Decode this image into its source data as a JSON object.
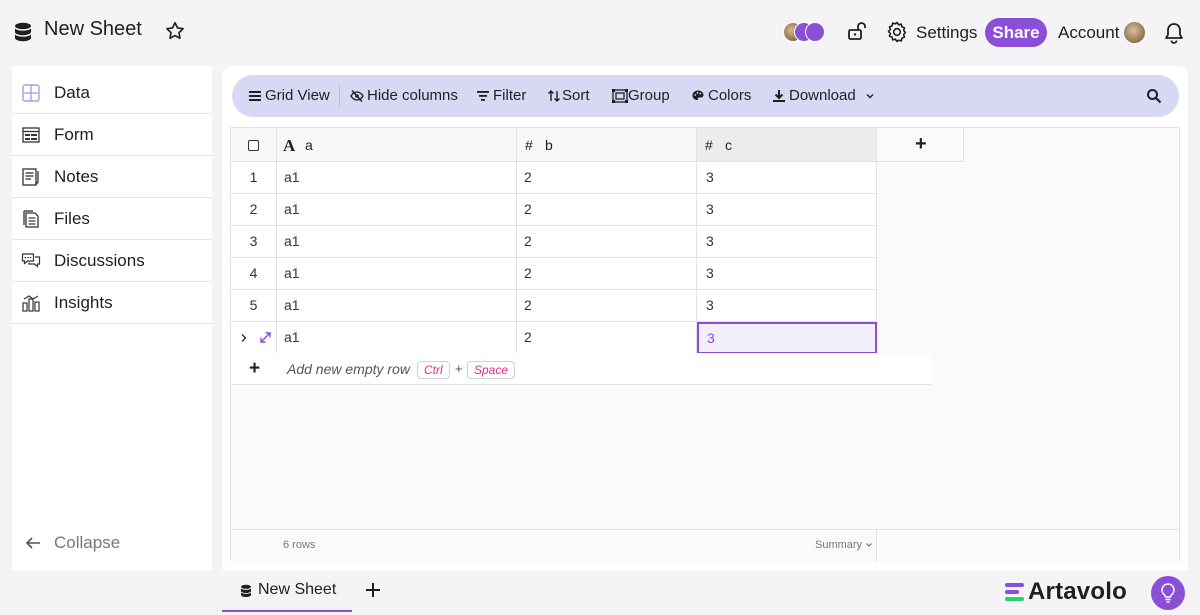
{
  "header": {
    "title": "New Sheet",
    "settings_label": "Settings",
    "share_label": "Share",
    "account_label": "Account"
  },
  "sidebar": {
    "items": [
      {
        "label": "Data",
        "icon": "grid-icon"
      },
      {
        "label": "Form",
        "icon": "form-icon"
      },
      {
        "label": "Notes",
        "icon": "notes-icon"
      },
      {
        "label": "Files",
        "icon": "files-icon"
      },
      {
        "label": "Discussions",
        "icon": "chat-icon"
      },
      {
        "label": "Insights",
        "icon": "insights-icon"
      }
    ],
    "collapse_label": "Collapse"
  },
  "toolbar": {
    "grid_view": "Grid View",
    "hide_columns": "Hide columns",
    "filter": "Filter",
    "sort": "Sort",
    "group": "Group",
    "colors": "Colors",
    "download": "Download"
  },
  "grid": {
    "columns": [
      {
        "type_symbol": "A",
        "name": "a"
      },
      {
        "type_symbol": "#",
        "name": "b"
      },
      {
        "type_symbol": "#",
        "name": "c"
      }
    ],
    "add_column_symbol": "+",
    "rows": [
      {
        "num": "1",
        "a": "a1",
        "b": "2",
        "c": "3"
      },
      {
        "num": "2",
        "a": "a1",
        "b": "2",
        "c": "3"
      },
      {
        "num": "3",
        "a": "a1",
        "b": "2",
        "c": "3"
      },
      {
        "num": "4",
        "a": "a1",
        "b": "2",
        "c": "3"
      },
      {
        "num": "5",
        "a": "a1",
        "b": "2",
        "c": "3"
      },
      {
        "num": "",
        "a": "a1",
        "b": "2",
        "c": "3"
      }
    ],
    "add_row_label": "Add new empty row",
    "add_row_key1": "Ctrl",
    "add_row_plus": "+",
    "add_row_key2": "Space",
    "row_count": "6 rows",
    "summary_label": "Summary"
  },
  "tabs": {
    "sheet_label": "New Sheet"
  },
  "brand": {
    "name": "Artavolo"
  },
  "colors": {
    "accent": "#8b4ed6",
    "toolbar_bg": "#d6d8f4"
  }
}
